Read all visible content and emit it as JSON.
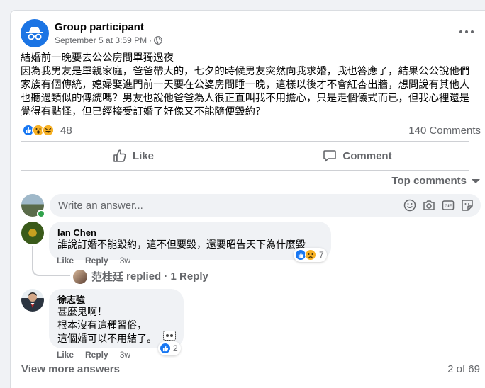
{
  "post": {
    "author": "Group participant",
    "date": "September 5 at 3:59 PM",
    "separator": "·",
    "body": "結婚前一晚要去公公房間單獨過夜\n因為我男友是單親家庭，爸爸帶大的，七夕的時候男友突然向我求婚，我也答應了，結果公公說他們家族有個傳統，媳婦娶進門前一天要在公婆房間睡一晚，這樣以後才不會紅杏出牆，想問說有其他人也聽過類似的傳統嗎？男友也說他爸爸為人很正直叫我不用擔心，只是走個儀式而已，但我心裡還是覺得有點怪，但已經接受訂婚了好像又不能隨便毀約？",
    "reaction_count": "48",
    "comments_count": "140 Comments"
  },
  "actions": {
    "like_label": "Like",
    "comment_label": "Comment"
  },
  "sort_label": "Top comments",
  "write": {
    "placeholder": "Write an answer..."
  },
  "comments": [
    {
      "name": "Ian Chen",
      "text": "誰說訂婚不能毀約，這不但要毀，還要昭告天下為什麼毀",
      "reactions": "7",
      "like": "Like",
      "reply": "Reply",
      "time": "3w"
    },
    {
      "name": "徐志強",
      "text": "甚麼鬼啊！\n根本沒有這種習俗，\n這個婚可以不用結了。",
      "reactions": "2",
      "like": "Like",
      "reply": "Reply",
      "time": "3w"
    }
  ],
  "replies_summary": {
    "name": "范桂廷",
    "suffix": "replied · 1 Reply"
  },
  "footer": {
    "view_more": "View more answers",
    "pager": "2 of 69"
  },
  "colors": {
    "accent": "#1877f2",
    "text_secondary": "#65676b",
    "bubble": "#f0f2f5"
  }
}
